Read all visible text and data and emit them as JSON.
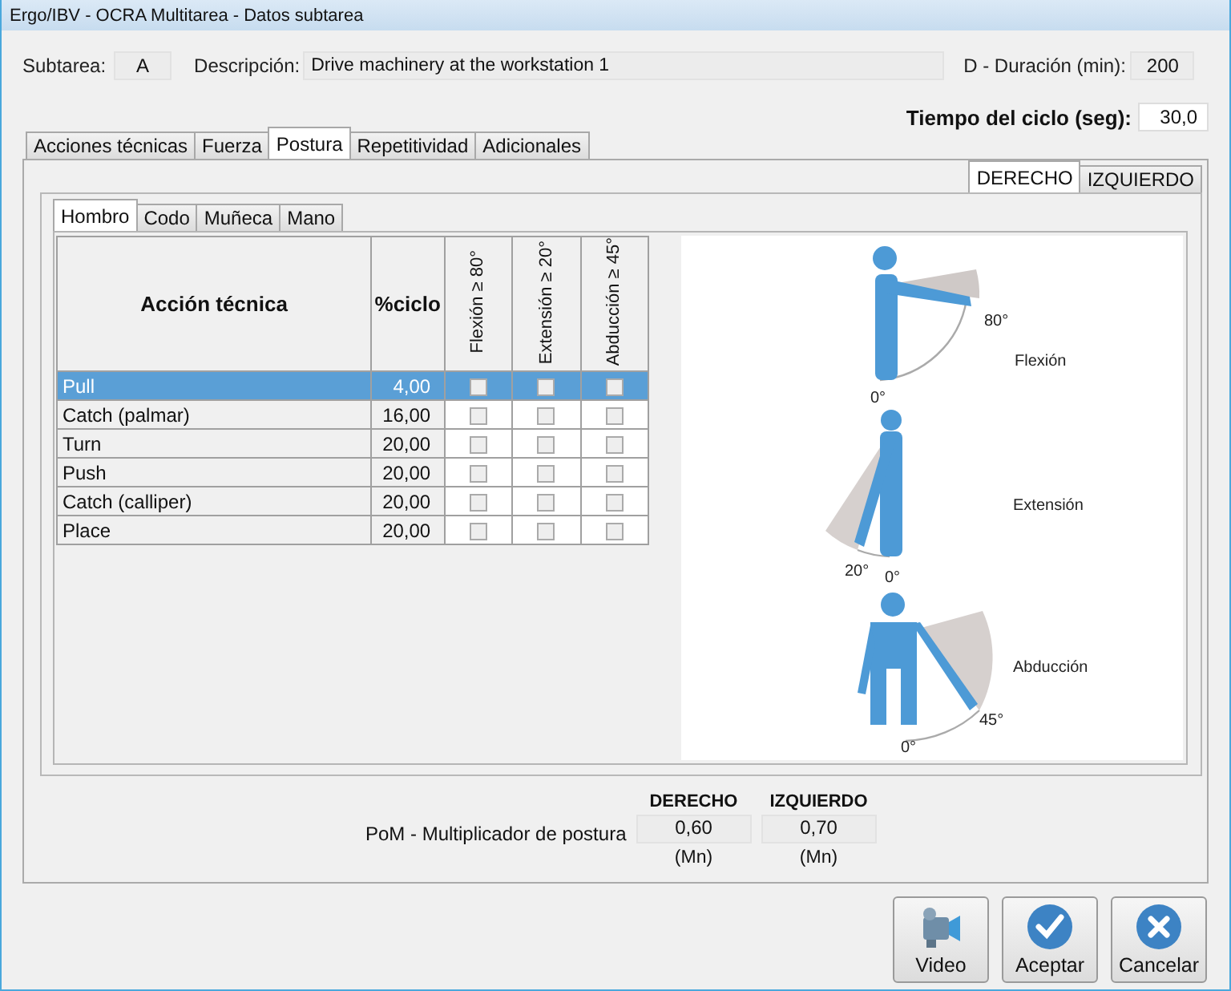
{
  "window": {
    "title": "Ergo/IBV - OCRA Multitarea - Datos subtarea"
  },
  "header": {
    "subtask_label": "Subtarea:",
    "subtask_value": "A",
    "description_label": "Descripción:",
    "description_value": "Drive machinery at the workstation 1",
    "duration_label": "D - Duración (min):",
    "duration_value": "200",
    "cycle_label": "Tiempo del ciclo (seg):",
    "cycle_value": "30,0"
  },
  "main_tabs": [
    {
      "label": "Acciones técnicas",
      "selected": false
    },
    {
      "label": "Fuerza",
      "selected": false
    },
    {
      "label": "Postura",
      "selected": true
    },
    {
      "label": "Repetitividad",
      "selected": false
    },
    {
      "label": "Adicionales",
      "selected": false
    }
  ],
  "side_tabs": [
    {
      "label": "DERECHO",
      "selected": true
    },
    {
      "label": "IZQUIERDO",
      "selected": false
    }
  ],
  "joint_tabs": [
    {
      "label": "Hombro",
      "selected": true
    },
    {
      "label": "Codo",
      "selected": false
    },
    {
      "label": "Muñeca",
      "selected": false
    },
    {
      "label": "Mano",
      "selected": false
    }
  ],
  "table": {
    "columns": [
      {
        "label": "Acción técnica",
        "kind": "text"
      },
      {
        "label": "%ciclo",
        "kind": "text"
      },
      {
        "label": "Flexión ≥ 80°",
        "kind": "check"
      },
      {
        "label": "Extensión ≥ 20°",
        "kind": "check"
      },
      {
        "label": "Abducción ≥ 45°",
        "kind": "check"
      }
    ],
    "rows": [
      {
        "action": "Pull",
        "percent": "4,00",
        "checks": [
          false,
          false,
          false
        ],
        "selected": true
      },
      {
        "action": "Catch (palmar)",
        "percent": "16,00",
        "checks": [
          false,
          false,
          false
        ],
        "selected": false
      },
      {
        "action": "Turn",
        "percent": "20,00",
        "checks": [
          false,
          false,
          false
        ],
        "selected": false
      },
      {
        "action": "Push",
        "percent": "20,00",
        "checks": [
          false,
          false,
          false
        ],
        "selected": false
      },
      {
        "action": "Catch (calliper)",
        "percent": "20,00",
        "checks": [
          false,
          false,
          false
        ],
        "selected": false
      },
      {
        "action": "Place",
        "percent": "20,00",
        "checks": [
          false,
          false,
          false
        ],
        "selected": false
      }
    ]
  },
  "illustration": [
    {
      "kind": "flexion",
      "name": "Flexión",
      "angle": "80°",
      "zero": "0°"
    },
    {
      "kind": "extension",
      "name": "Extensión",
      "angle": "20°",
      "zero": "0°"
    },
    {
      "kind": "abduction",
      "name": "Abducción",
      "angle": "45°",
      "zero": "0°"
    }
  ],
  "multiplier": {
    "label": "PoM - Multiplicador de postura",
    "columns": [
      {
        "heading": "DERECHO",
        "value": "0,60",
        "unit": "(Mn)"
      },
      {
        "heading": "IZQUIERDO",
        "value": "0,70",
        "unit": "(Mn)"
      }
    ]
  },
  "buttons": [
    {
      "label": "Video",
      "kind": "video"
    },
    {
      "label": "Aceptar",
      "kind": "accept"
    },
    {
      "label": "Cancelar",
      "kind": "cancel"
    }
  ]
}
